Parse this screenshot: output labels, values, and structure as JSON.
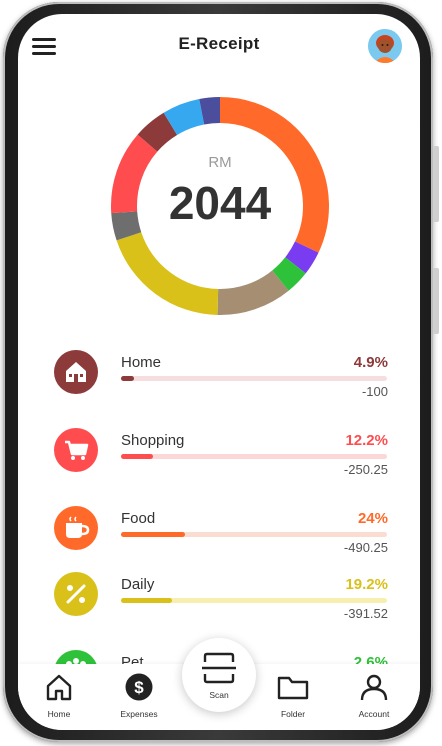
{
  "header": {
    "title": "E-Receipt"
  },
  "summary": {
    "unit": "RM",
    "total": "2044"
  },
  "chart_data": {
    "type": "pie",
    "center_label": "RM",
    "center_value": "2044",
    "slices_clockwise_from_top": [
      {
        "color": "#ff6a2a",
        "value": 31.5
      },
      {
        "color": "#7a3cf0",
        "value": 3.5
      },
      {
        "color": "#2ec23a",
        "value": 3.5
      },
      {
        "color": "#a58e71",
        "value": 11
      },
      {
        "color": "#d9c11a",
        "value": 19.2
      },
      {
        "color": "#6e6e6e",
        "value": 4
      },
      {
        "color": "#ff4d4f",
        "value": 12.2
      },
      {
        "color": "#8c3a3a",
        "value": 4.9
      },
      {
        "color": "#36a8f0",
        "value": 5.5
      },
      {
        "color": "#4a4e9c",
        "value": 3
      }
    ]
  },
  "categories": [
    {
      "name": "Home",
      "percent": "4.9%",
      "amount": "-100",
      "fraction": 0.049,
      "color": "#8c3a3a",
      "track": "#f7dede",
      "icon": "house-icon"
    },
    {
      "name": "Shopping",
      "percent": "12.2%",
      "amount": "-250.25",
      "fraction": 0.122,
      "color": "#ff4d4f",
      "track": "#fbd7d7",
      "icon": "shopping-cart-icon"
    },
    {
      "name": "Food",
      "percent": "24%",
      "amount": "-490.25",
      "fraction": 0.24,
      "color": "#ff6a2a",
      "track": "#fbdcd0",
      "icon": "coffee-cup-icon"
    },
    {
      "name": "Daily",
      "percent": "19.2%",
      "amount": "-391.52",
      "fraction": 0.192,
      "color": "#d9c11a",
      "track": "#f6efb0",
      "icon": "percent-tag-icon"
    },
    {
      "name": "Pet",
      "percent": "2.6%",
      "amount": "",
      "fraction": 0.026,
      "color": "#2ec23a",
      "track": "#d4f3d7",
      "icon": "paw-icon"
    }
  ],
  "nav": {
    "home": "Home",
    "expenses": "Expenses",
    "scan": "Scan",
    "folder": "Folder",
    "account": "Account"
  }
}
